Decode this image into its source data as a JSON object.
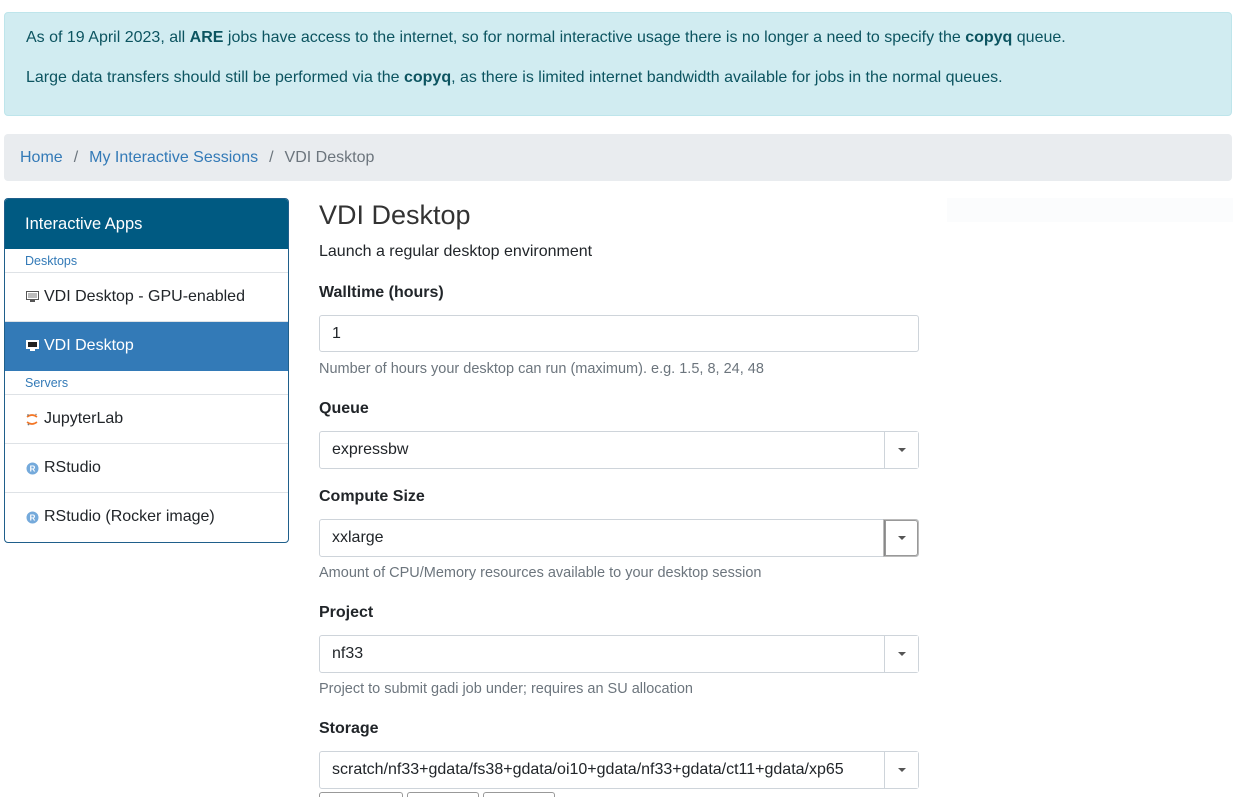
{
  "alert": {
    "line1": {
      "pre": "As of 19 April 2023, all ",
      "b1": "ARE",
      "mid": " jobs have access to the internet, so for normal interactive usage there is no longer a need to specify the ",
      "b2": "copyq",
      "post": " queue."
    },
    "line2": {
      "pre": "Large data transfers should still be performed via the ",
      "b1": "copyq",
      "post": ", as there is limited internet bandwidth available for jobs in the normal queues."
    }
  },
  "breadcrumb": {
    "items": [
      "Home",
      "My Interactive Sessions"
    ],
    "separator": "/",
    "current": "VDI Desktop"
  },
  "sidebar": {
    "header": "Interactive Apps",
    "sections": [
      {
        "title": "Desktops",
        "items": [
          {
            "label": "VDI Desktop - GPU-enabled",
            "icon": "monitor-icon"
          },
          {
            "label": "VDI Desktop",
            "icon": "monitor-icon",
            "active": true
          }
        ]
      },
      {
        "title": "Servers",
        "items": [
          {
            "label": "JupyterLab",
            "icon": "jupyter-icon"
          },
          {
            "label": "RStudio",
            "icon": "r-icon"
          },
          {
            "label": "RStudio (Rocker image)",
            "icon": "r-icon"
          }
        ]
      }
    ]
  },
  "form": {
    "title": "VDI Desktop",
    "subtitle": "Launch a regular desktop environment",
    "walltime": {
      "label": "Walltime (hours)",
      "value": "1",
      "help": "Number of hours your desktop can run (maximum). e.g. 1.5, 8, 24, 48"
    },
    "queue": {
      "label": "Queue",
      "value": "expressbw"
    },
    "compute_size": {
      "label": "Compute Size",
      "value": "xxlarge",
      "help": "Amount of CPU/Memory resources available to your desktop session"
    },
    "project": {
      "label": "Project",
      "value": "nf33",
      "help": "Project to submit gadi job under; requires an SU allocation"
    },
    "storage": {
      "label": "Storage",
      "value": "scratch/nf33+gdata/fs38+gdata/oi10+gdata/nf33+gdata/ct11+gdata/xp65"
    }
  },
  "colors": {
    "accent": "#337ab7",
    "sidebar_header": "#005a82",
    "alert_bg": "#d1ecf1",
    "alert_text": "#0c5460"
  }
}
